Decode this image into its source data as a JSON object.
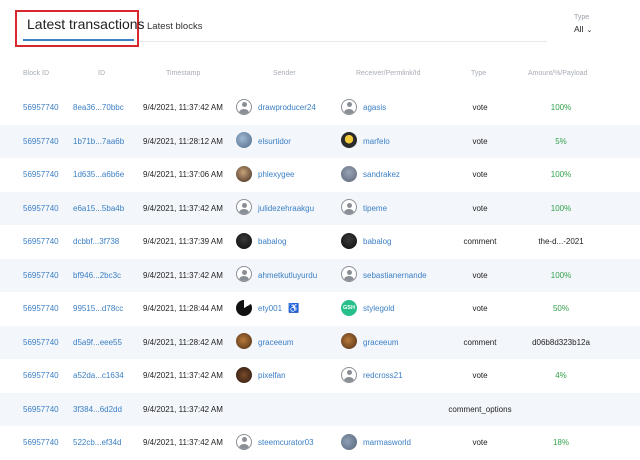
{
  "tabs": {
    "active": "Latest transactions",
    "blocks": "Latest blocks"
  },
  "filter": {
    "label": "Type",
    "value": "All"
  },
  "table": {
    "headers": {
      "block_id": "Block ID",
      "id": "ID",
      "timestamp": "Timestamp",
      "sender": "Sender",
      "receiver": "Receiver/Permlink/Id",
      "type": "Type",
      "amount": "Amount/%/Payload"
    },
    "rows": [
      {
        "block": "56957740",
        "id": "8ea36...70bbc",
        "ts": "9/4/2021, 11:37:42 AM",
        "sender": "drawproducer24",
        "sender_avatar": "default",
        "receiver": "agasis",
        "receiver_avatar": "default",
        "type": "vote",
        "amount": "100%",
        "amount_style": "green"
      },
      {
        "block": "56957740",
        "id": "1b71b...7aa6b",
        "ts": "9/4/2021, 11:28:12 AM",
        "sender": "elsurtidor",
        "sender_avatar": "photo1",
        "receiver": "marfelo",
        "receiver_avatar": "photo2",
        "type": "vote",
        "amount": "5%",
        "amount_style": "green"
      },
      {
        "block": "56957740",
        "id": "1d635...a6b6e",
        "ts": "9/4/2021, 11:37:06 AM",
        "sender": "phlexygee",
        "sender_avatar": "photo3",
        "receiver": "sandrakez",
        "receiver_avatar": "photo4",
        "type": "vote",
        "amount": "100%",
        "amount_style": "green"
      },
      {
        "block": "56957740",
        "id": "e6a15...5ba4b",
        "ts": "9/4/2021, 11:37:42 AM",
        "sender": "julidezehraakgu",
        "sender_avatar": "default",
        "receiver": "tipeme",
        "receiver_avatar": "default",
        "type": "vote",
        "amount": "100%",
        "amount_style": "green"
      },
      {
        "block": "56957740",
        "id": "dcbbf...3f738",
        "ts": "9/4/2021, 11:37:39 AM",
        "sender": "babalog",
        "sender_avatar": "photo5",
        "receiver": "babalog",
        "receiver_avatar": "photo5",
        "type": "comment",
        "amount": "the-d...-2021",
        "amount_style": "dark"
      },
      {
        "block": "56957740",
        "id": "bf946...2bc3c",
        "ts": "9/4/2021, 11:37:42 AM",
        "sender": "ahmetkutluyurdu",
        "sender_avatar": "default",
        "receiver": "sebastianernande",
        "receiver_avatar": "default",
        "type": "vote",
        "amount": "100%",
        "amount_style": "green"
      },
      {
        "block": "56957740",
        "id": "99515...d78cc",
        "ts": "9/4/2021, 11:28:44 AM",
        "sender": "ety001",
        "sender_avatar": "pac",
        "receiver": "stylegold",
        "receiver_avatar": "gsh",
        "gsh_text": "GSH",
        "type": "vote",
        "amount": "50%",
        "amount_style": "green"
      },
      {
        "block": "56957740",
        "id": "d5a9f...eee55",
        "ts": "9/4/2021, 11:28:42 AM",
        "sender": "graceeum",
        "sender_avatar": "photo6",
        "receiver": "graceeum",
        "receiver_avatar": "photo6",
        "type": "comment",
        "amount": "d06b8d323b12a",
        "amount_style": "dark"
      },
      {
        "block": "56957740",
        "id": "a52da...c1634",
        "ts": "9/4/2021, 11:37:42 AM",
        "sender": "pixelfan",
        "sender_avatar": "photo7",
        "receiver": "redcross21",
        "receiver_avatar": "default",
        "type": "vote",
        "amount": "4%",
        "amount_style": "green"
      },
      {
        "block": "56957740",
        "id": "3f384...6d2dd",
        "ts": "9/4/2021, 11:37:42 AM",
        "sender": "",
        "sender_avatar": "none",
        "receiver": "",
        "receiver_avatar": "none",
        "type": "comment_options",
        "amount": "",
        "amount_style": "dark"
      },
      {
        "block": "56957740",
        "id": "522cb...ef34d",
        "ts": "9/4/2021, 11:37:42 AM",
        "sender": "steemcurator03",
        "sender_avatar": "default",
        "receiver": "marmasworld",
        "receiver_avatar": "photo8",
        "type": "vote",
        "amount": "18%",
        "amount_style": "green"
      }
    ]
  }
}
